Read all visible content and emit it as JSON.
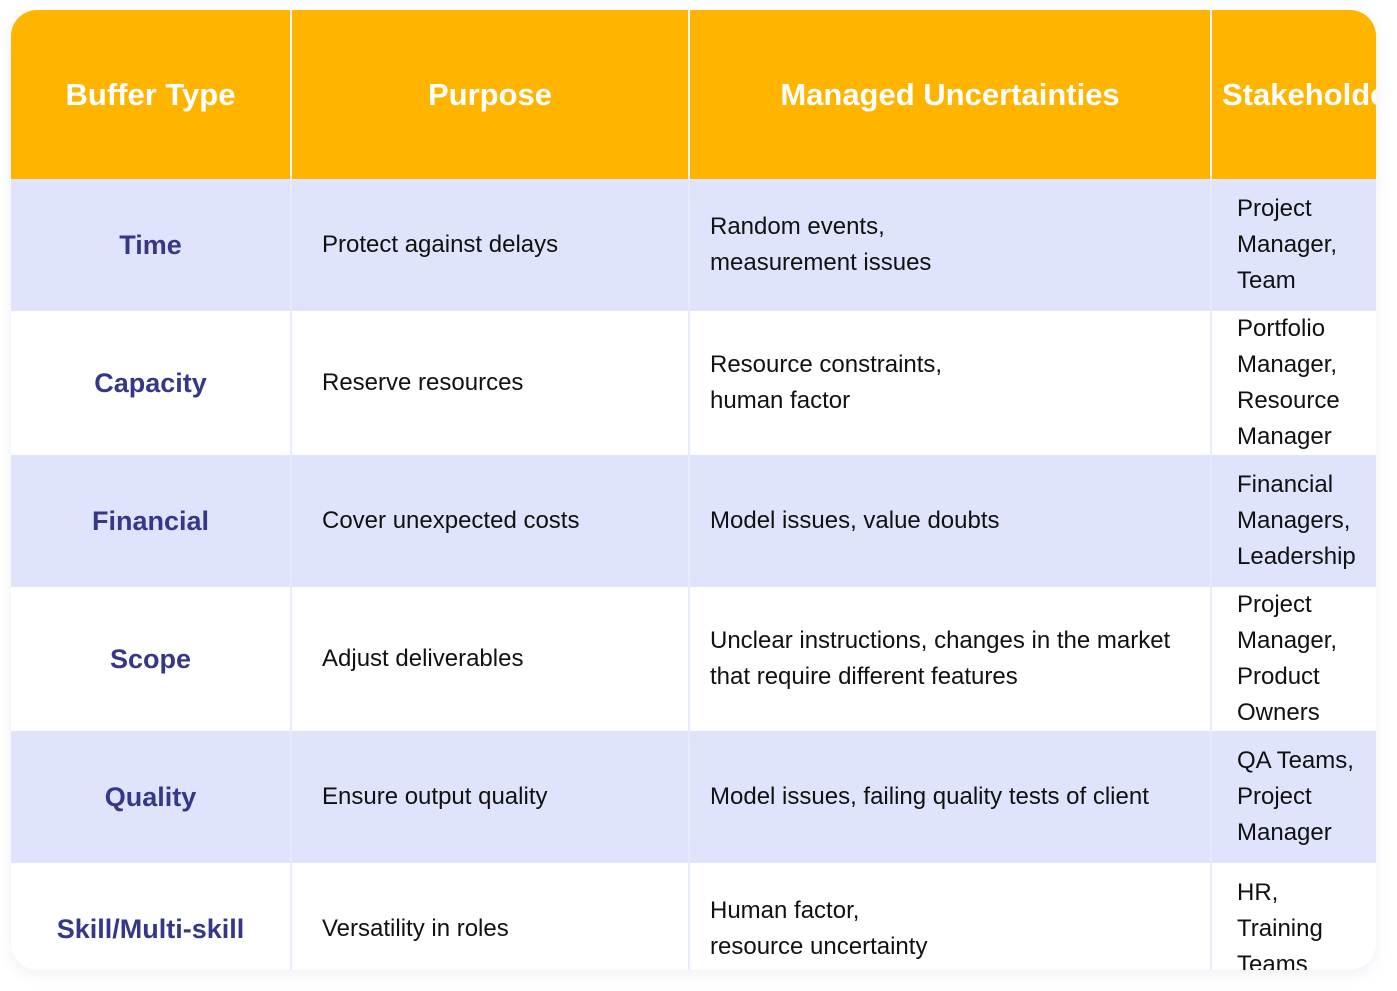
{
  "colors": {
    "header": "#FFB400",
    "alt_row": "#DFE4FC",
    "type_text": "#343887"
  },
  "headers": [
    "Buffer Type",
    "Purpose",
    "Managed Uncertainties",
    "Stakeholders"
  ],
  "rows": [
    {
      "type": "Time",
      "purpose": "Protect against delays",
      "uncertainties": "Random events,\nmeasurement issues",
      "stakeholders": "Project Manager, Team"
    },
    {
      "type": "Capacity",
      "purpose": "Reserve resources",
      "uncertainties": "Resource constraints,\nhuman factor",
      "stakeholders": "Portfolio Manager,\nResource Manager"
    },
    {
      "type": "Financial",
      "purpose": "Cover unexpected costs",
      "uncertainties": "Model issues, value doubts",
      "stakeholders": "Financial Managers,\nLeadership"
    },
    {
      "type": "Scope",
      "purpose": "Adjust deliverables",
      "uncertainties": "Unclear instructions, changes in the market that require different features",
      "stakeholders": "Project Manager,\nProduct Owners"
    },
    {
      "type": "Quality",
      "purpose": "Ensure output quality",
      "uncertainties": "Model issues, failing quality tests of client",
      "stakeholders": "QA Teams,\nProject Manager"
    },
    {
      "type": "Skill/Multi-skill",
      "purpose": "Versatility in roles",
      "uncertainties": "Human factor,\nresource uncertainty",
      "stakeholders": "HR, Training Teams"
    }
  ]
}
